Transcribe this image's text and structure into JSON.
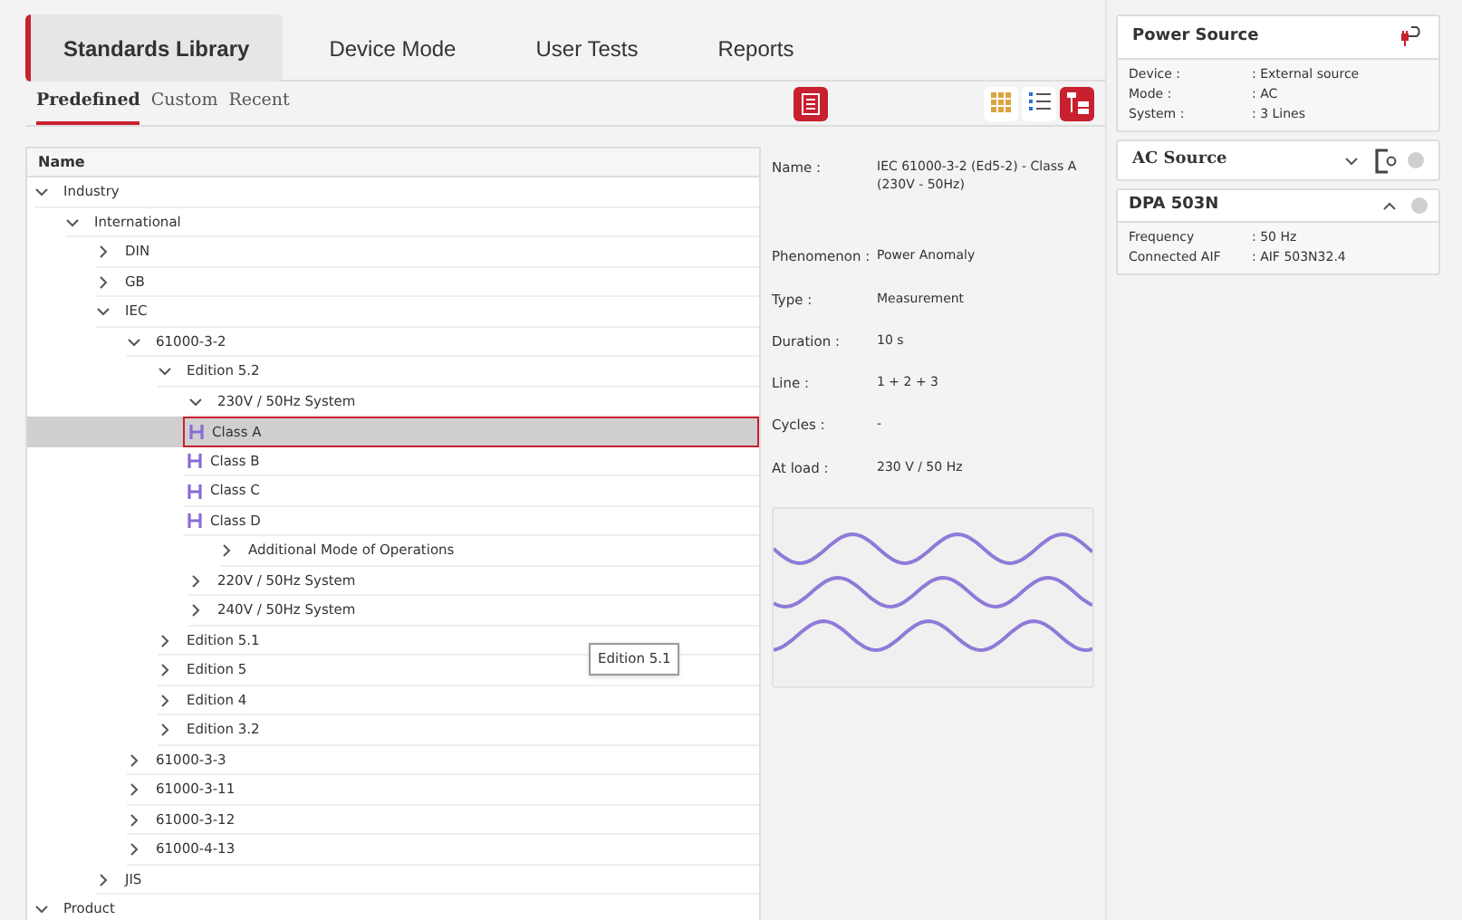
{
  "tabs": [
    {
      "label": "Standards Library",
      "selected": true
    },
    {
      "label": "Device Mode",
      "selected": false
    },
    {
      "label": "User Tests",
      "selected": false
    },
    {
      "label": "Reports",
      "selected": false
    }
  ],
  "subtabs": [
    {
      "label": "Predefined",
      "selected": true
    },
    {
      "label": "Custom",
      "selected": false
    },
    {
      "label": "Recent",
      "selected": false
    }
  ],
  "view_buttons": [
    {
      "kind": "grid",
      "selected": false
    },
    {
      "kind": "list",
      "selected": false
    },
    {
      "kind": "tree",
      "selected": true
    }
  ],
  "tree": {
    "header": "Name",
    "items": [
      {
        "label": "Industry",
        "expanded": true,
        "children": [
          {
            "label": "International",
            "expanded": true,
            "children": [
              {
                "label": "DIN",
                "expanded": false
              },
              {
                "label": "GB",
                "expanded": false
              },
              {
                "label": "IEC",
                "expanded": true,
                "children": [
                  {
                    "label": "61000-3-2",
                    "expanded": true,
                    "children": [
                      {
                        "label": "Edition 5.2",
                        "expanded": true,
                        "children": [
                          {
                            "label": "230V / 50Hz System",
                            "expanded": true,
                            "children": [
                              {
                                "label": "Class A",
                                "kind": "standard",
                                "selected": true
                              },
                              {
                                "label": "Class B",
                                "kind": "standard",
                                "selected": false
                              },
                              {
                                "label": "Class C",
                                "kind": "standard",
                                "selected": false
                              },
                              {
                                "label": "Class D",
                                "kind": "standard",
                                "selected": false
                              },
                              {
                                "label": "Additional Mode of Operations",
                                "expanded": false
                              }
                            ]
                          },
                          {
                            "label": "220V / 50Hz System",
                            "expanded": false
                          },
                          {
                            "label": "240V / 50Hz System",
                            "expanded": false
                          }
                        ]
                      },
                      {
                        "label": "Edition 5.1",
                        "expanded": false
                      },
                      {
                        "label": "Edition 5",
                        "expanded": false
                      },
                      {
                        "label": "Edition 4",
                        "expanded": false
                      },
                      {
                        "label": "Edition 3.2",
                        "expanded": false
                      }
                    ]
                  },
                  {
                    "label": "61000-3-3",
                    "expanded": false
                  },
                  {
                    "label": "61000-3-11",
                    "expanded": false
                  },
                  {
                    "label": "61000-3-12",
                    "expanded": false
                  },
                  {
                    "label": "61000-4-13",
                    "expanded": false
                  }
                ]
              },
              {
                "label": "JIS",
                "expanded": false
              }
            ]
          }
        ]
      },
      {
        "label": "Product",
        "expanded": true
      }
    ]
  },
  "tooltip": "Edition 5.1",
  "details": [
    {
      "label": "Name :",
      "value": "IEC 61000-3-2 (Ed5-2) - Class A (230V - 50Hz)"
    },
    {
      "label": "Phenomenon :",
      "value": "Power Anomaly"
    },
    {
      "label": "Type :",
      "value": "Measurement"
    },
    {
      "label": "Duration :",
      "value": "10 s"
    },
    {
      "label": "Line :",
      "value": "1 + 2 + 3"
    },
    {
      "label": "Cycles :",
      "value": "-"
    },
    {
      "label": "At load :",
      "value": "230 V / 50 Hz"
    }
  ],
  "power_source": {
    "title": "Power Source",
    "rows": [
      {
        "label": "Device :",
        "value": ": External source"
      },
      {
        "label": "Mode :",
        "value": ": AC"
      },
      {
        "label": "System :",
        "value": ": 3 Lines"
      }
    ]
  },
  "ac_source": {
    "title": "AC Source",
    "expanded": false
  },
  "dpa": {
    "title": "DPA 503N",
    "expanded": true,
    "rows": [
      {
        "label": "Frequency",
        "value": ": 50 Hz"
      },
      {
        "label": "Connected AIF",
        "value": ": AIF 503N32.4"
      }
    ]
  }
}
